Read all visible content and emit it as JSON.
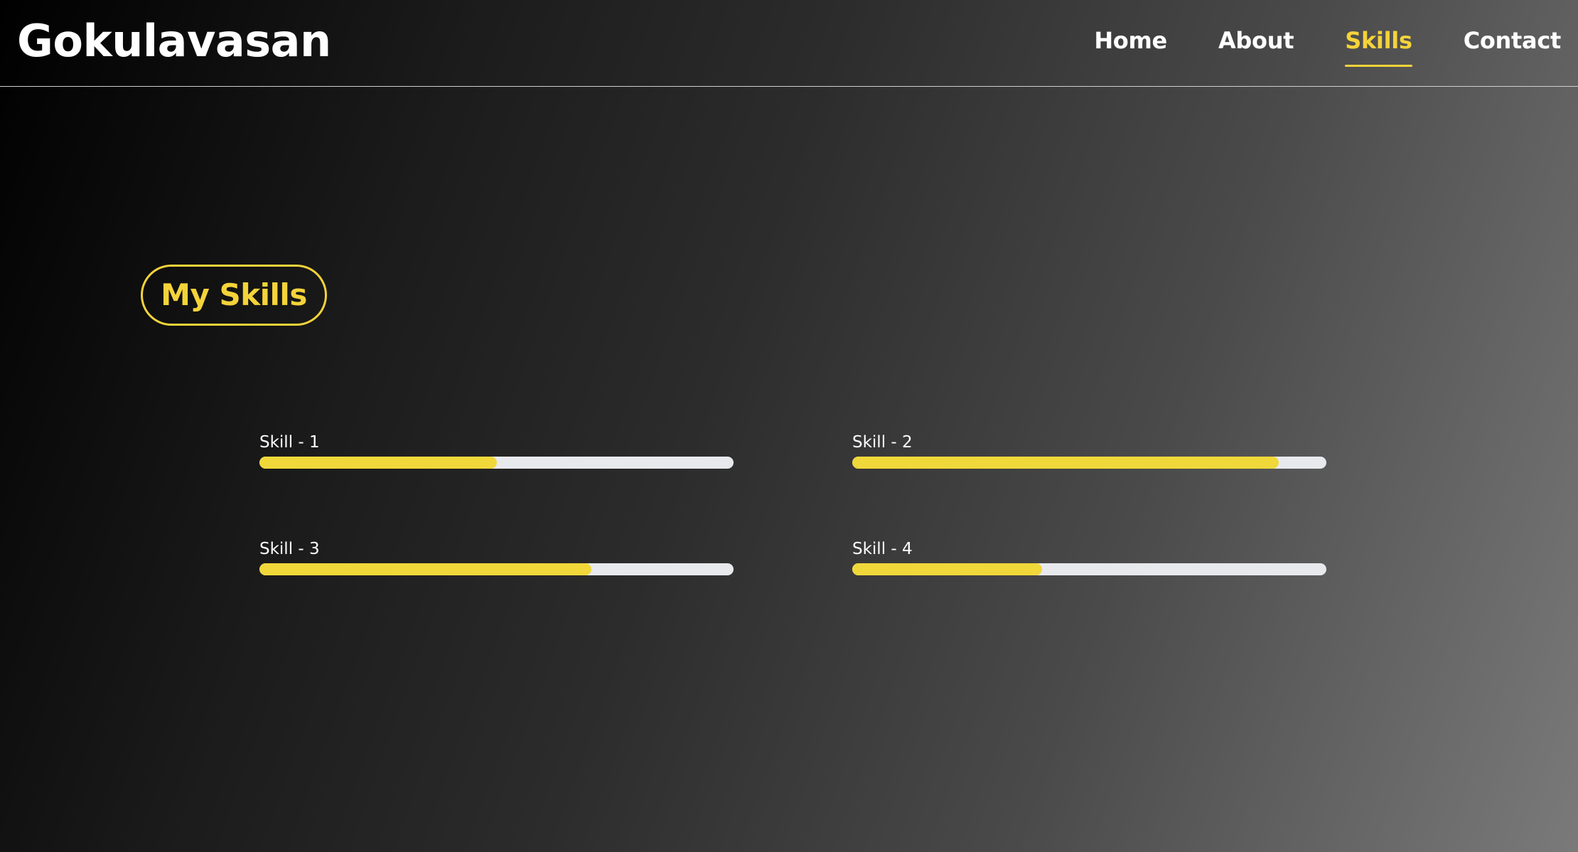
{
  "header": {
    "logo": "Gokulavasan",
    "nav": [
      {
        "label": "Home",
        "active": false
      },
      {
        "label": "About",
        "active": false
      },
      {
        "label": "Skills",
        "active": true
      },
      {
        "label": "Contact",
        "active": false
      }
    ]
  },
  "skills_section": {
    "title": "My Skills",
    "skills": [
      {
        "label": "Skill - 1",
        "progress_percent": 50
      },
      {
        "label": "Skill - 2",
        "progress_percent": 90
      },
      {
        "label": "Skill - 3",
        "progress_percent": 70
      },
      {
        "label": "Skill - 4",
        "progress_percent": 40
      }
    ]
  },
  "colors": {
    "accent": "#f4d33a",
    "track": "#e8e9ed",
    "text": "#ffffff"
  }
}
